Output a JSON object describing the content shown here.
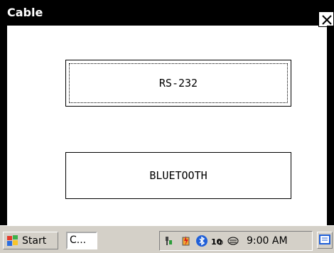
{
  "window": {
    "title": "Cable",
    "close_label": "close"
  },
  "buttons": {
    "rs232": "RS-232",
    "bluetooth": "BLUETOOTH"
  },
  "taskbar": {
    "start": "Start",
    "task": "C...",
    "clock": "9:00 AM"
  }
}
